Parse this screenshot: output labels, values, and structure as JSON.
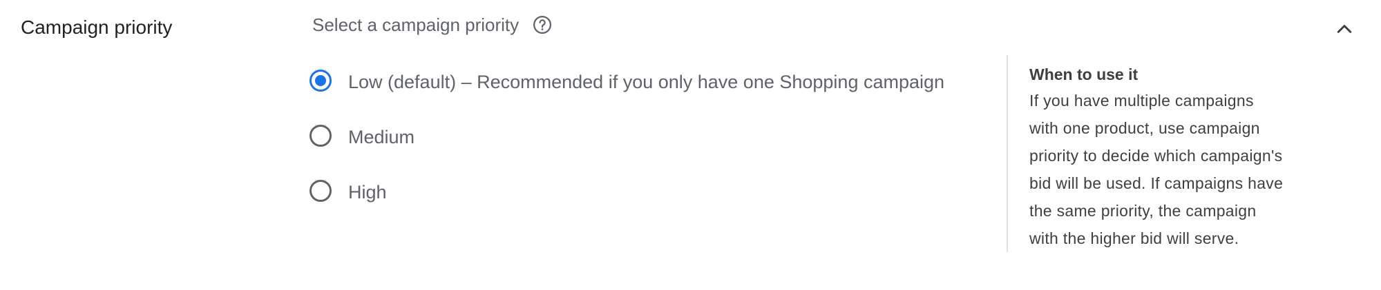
{
  "section": {
    "title": "Campaign priority",
    "subheader": "Select a campaign priority",
    "help_icon": "help-circle-icon",
    "collapse_icon": "chevron-up-icon"
  },
  "options": [
    {
      "label": "Low (default) – Recommended if you only have one Shopping campaign",
      "selected": true
    },
    {
      "label": "Medium",
      "selected": false
    },
    {
      "label": "High",
      "selected": false
    }
  ],
  "help_panel": {
    "heading": "When to use it",
    "lines": [
      "If you have multiple campaigns",
      "with one product, use campaign",
      "priority to decide which campaign's",
      "bid will be used. If campaigns have",
      "the same priority, the campaign",
      "with the higher bid will serve."
    ]
  },
  "colors": {
    "accent": "#1a73e8",
    "text_primary": "#202124",
    "text_secondary": "#5f6368",
    "divider": "#e0e0e0"
  }
}
